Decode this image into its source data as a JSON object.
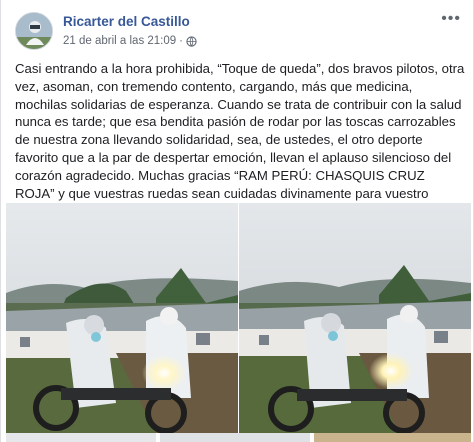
{
  "post": {
    "author": "Ricarter del Castillo",
    "timestamp": "21 de abril a las 21:09",
    "separator": "·",
    "privacy_icon": "globe-icon",
    "more_icon": "more-options-icon",
    "more_label": "•••",
    "body": "Casi entrando a la hora prohibida, “Toque de queda”, dos bravos pilotos, otra vez, asoman, con tremendo contento, cargando, más que medicina, mochilas solidarias de esperanza. Cuando se trata de contribuir con la salud nunca es tarde; que esa bendita pasión de rodar por las toscas carrozables de nuestra zona llevando solidaridad, sea, de ustedes, el otro deporte favorito que a la par de despertar emoción, llevan el aplauso silencioso del corazón agradecido. Muchas gracias “RAM PERÚ: CHASQUIS CRUZ ROJA” y que vuestras ruedas sean cuidadas divinamente para vuestro retorno con bien."
  },
  "colors": {
    "author_link": "#385898",
    "meta_text": "#606770",
    "body_text": "#1c1e21",
    "divider": "#dddfe2"
  }
}
